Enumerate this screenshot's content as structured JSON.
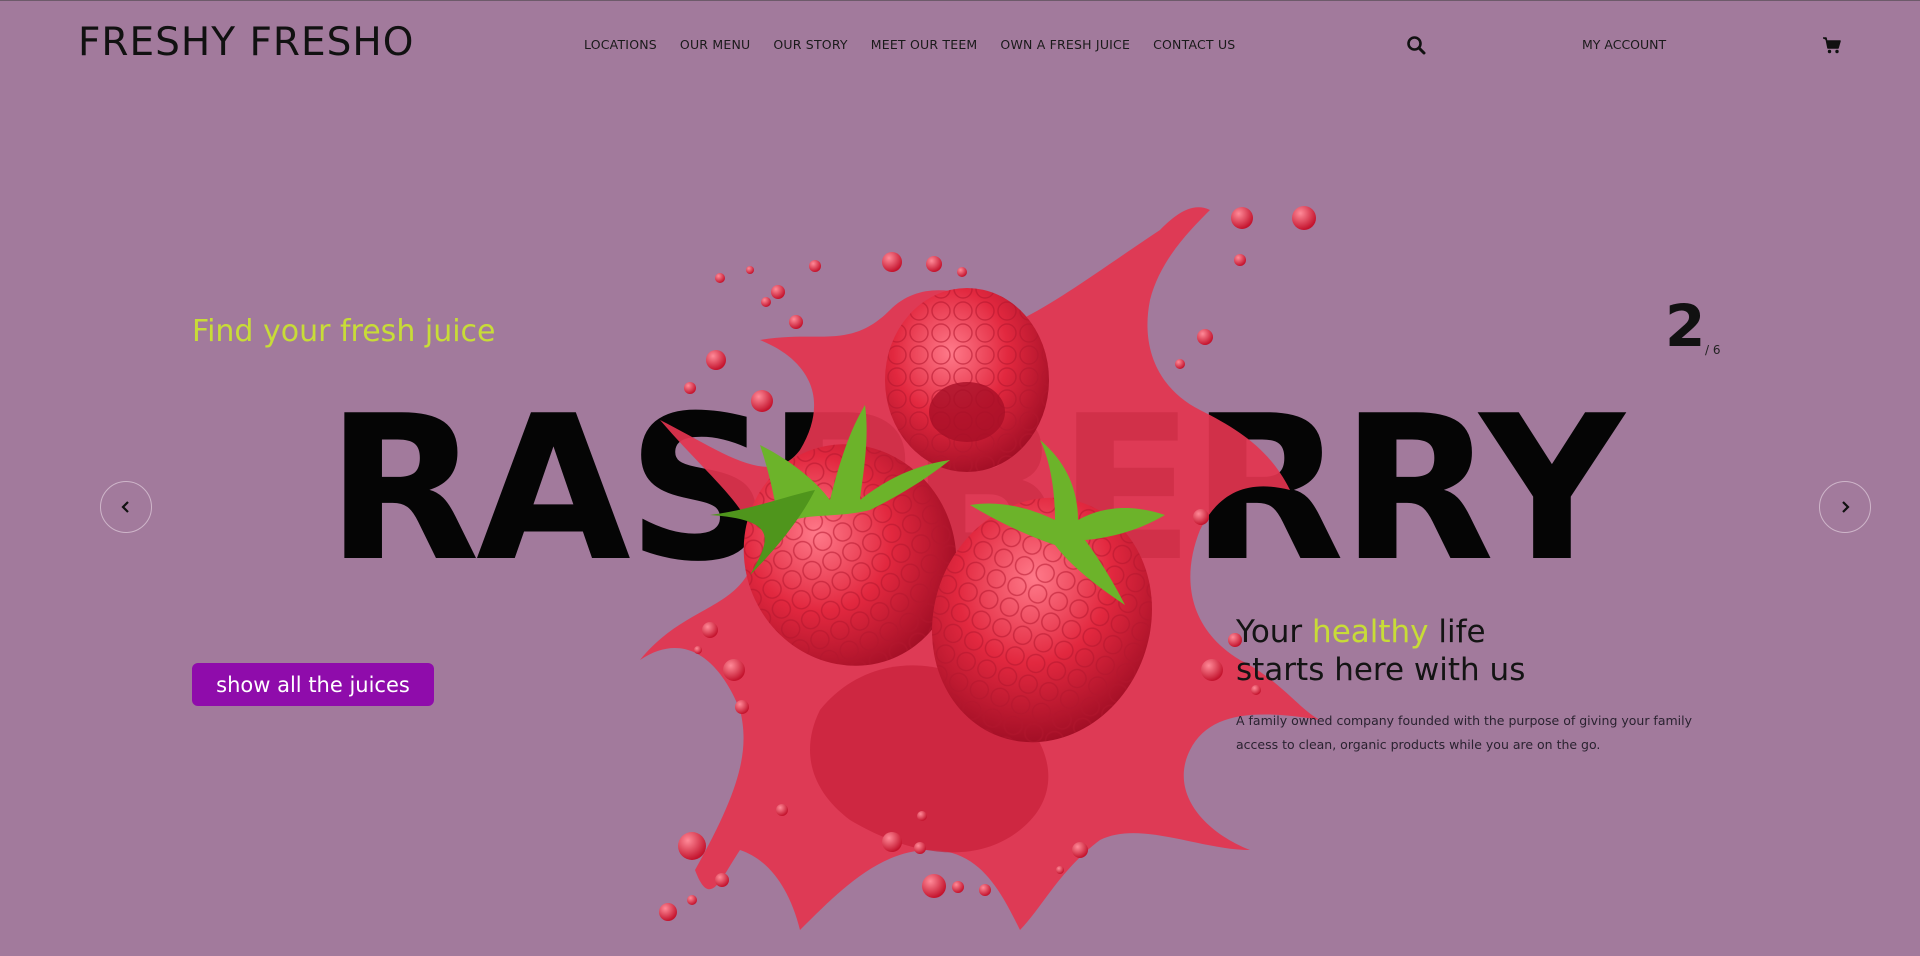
{
  "header": {
    "brand": "FRESHY FRESHO",
    "nav": [
      "LOCATIONS",
      "OUR MENU",
      "OUR STORY",
      "MEET OUR TEEM",
      "OWN A FRESH JUICE",
      "CONTACT US"
    ],
    "account_label": "MY ACCOUNT"
  },
  "hero": {
    "tagline": "Find your fresh juice",
    "fruit_name": "RASPBERRY",
    "slide_current": "2",
    "slide_total": "/ 6",
    "cta_label": "show all the juices",
    "headline_prefix": "Your",
    "headline_highlight": "healthy",
    "headline_suffix": "life",
    "headline_line2": "starts here with us",
    "description": "A family owned company founded with the purpose of giving your family access to clean, organic products while you are on the go."
  },
  "icons": {
    "search": "search-icon",
    "cart": "cart-icon",
    "prev": "chevron-left-icon",
    "next": "chevron-right-icon"
  },
  "colors": {
    "background": "#a27a9c",
    "accent_green": "#c8dc37",
    "button": "#8f0cab",
    "raspberry": "#e2283f"
  }
}
